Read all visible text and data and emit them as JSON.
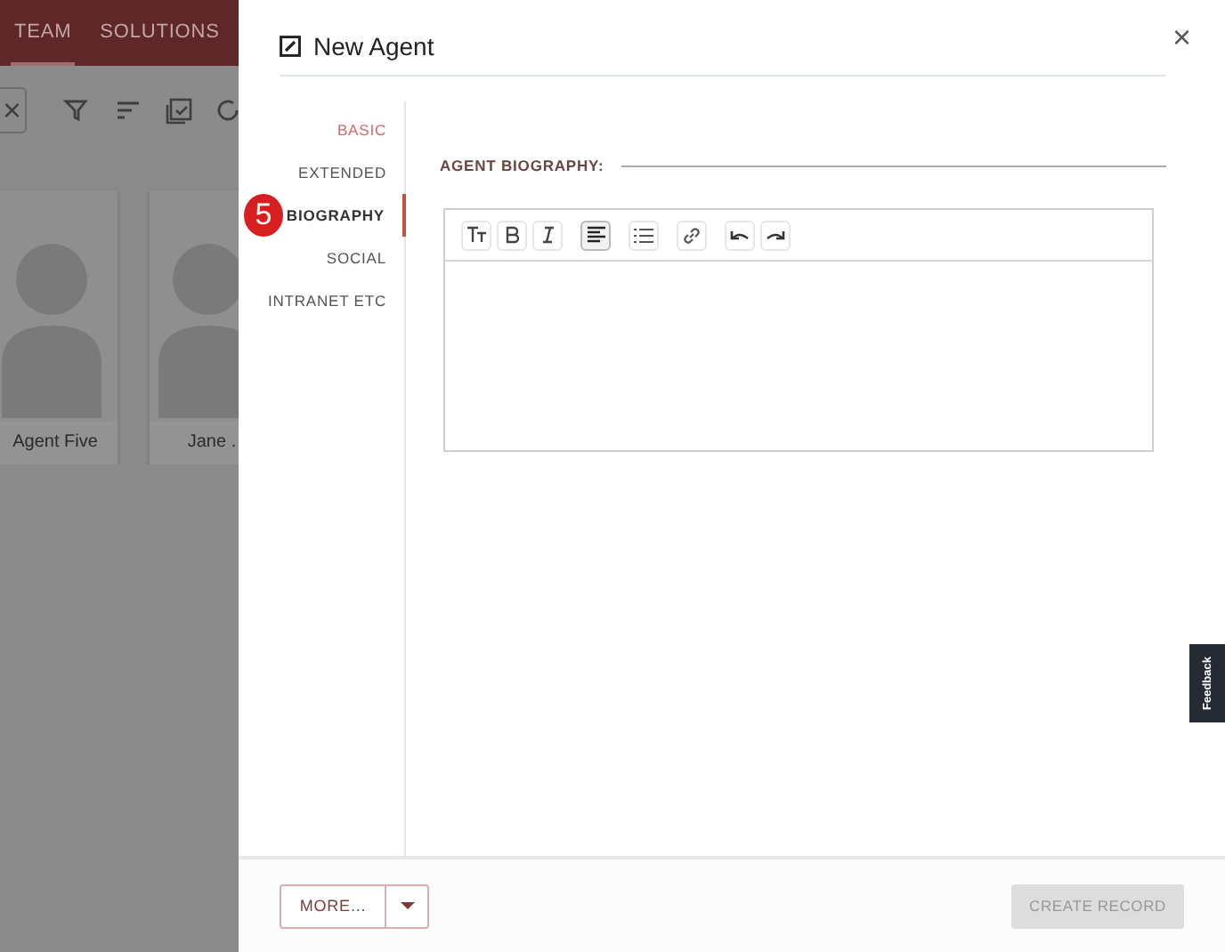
{
  "background": {
    "nav_tabs": [
      {
        "label": "TEAM",
        "selected": true
      },
      {
        "label": "SOLUTIONS",
        "selected": false
      }
    ],
    "toolbar": {
      "clear": "×"
    },
    "cards": [
      {
        "name": "Agent Five"
      },
      {
        "name": "Jane ."
      }
    ]
  },
  "panel": {
    "title": "New Agent",
    "close": "×",
    "nav": [
      {
        "label": "BASIC",
        "selected": false,
        "visited": true
      },
      {
        "label": "EXTENDED",
        "selected": false,
        "visited": false
      },
      {
        "label": "BIOGRAPHY",
        "selected": true,
        "visited": false
      },
      {
        "label": "SOCIAL",
        "selected": false,
        "visited": false
      },
      {
        "label": "INTRANET ETC",
        "selected": false,
        "visited": false
      }
    ],
    "step_badge": "5",
    "section_label": "AGENT BIOGRAPHY:",
    "editor": {
      "tools": [
        {
          "kind": "text-size",
          "active": false
        },
        {
          "kind": "bold",
          "active": false
        },
        {
          "kind": "italic",
          "active": false
        },
        {
          "kind": "align",
          "active": true
        },
        {
          "kind": "list",
          "active": false
        },
        {
          "kind": "link",
          "active": false
        },
        {
          "kind": "undo",
          "active": false
        },
        {
          "kind": "redo",
          "active": false
        }
      ]
    },
    "footer": {
      "more": "MORE...",
      "create": {
        "label": "CREATE RECORD",
        "disabled": true
      }
    }
  },
  "feedback": "Feedback"
}
